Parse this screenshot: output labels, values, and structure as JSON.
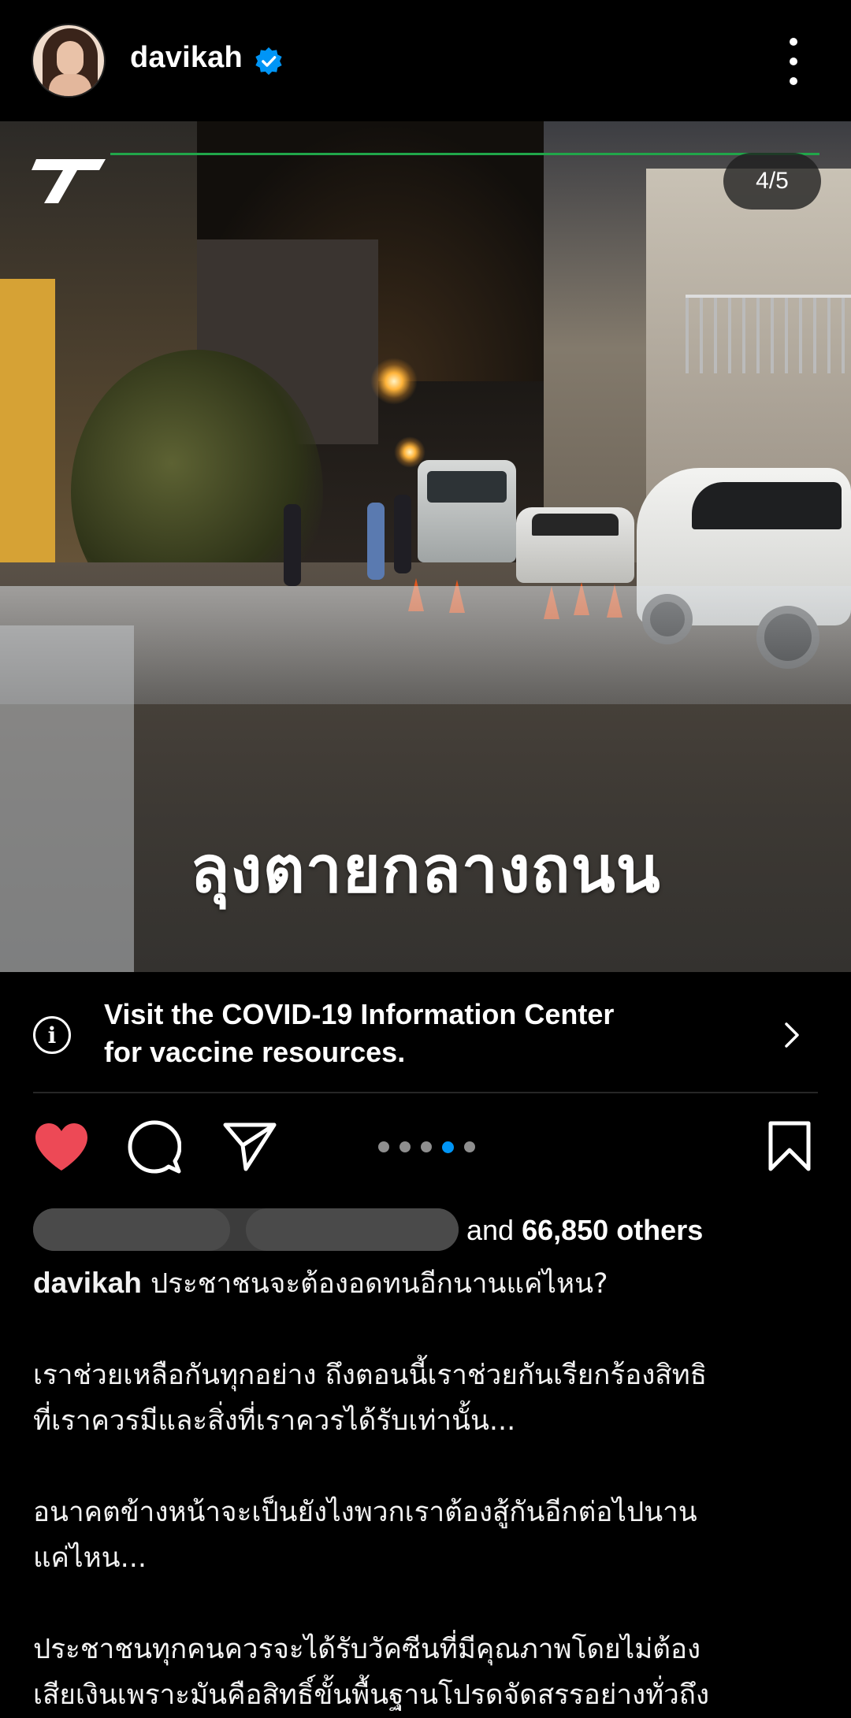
{
  "post": {
    "username": "davikah",
    "verified": true,
    "carousel_counter": "4/5",
    "carousel_total": 5,
    "carousel_active": 4,
    "image_overlay_text": "ลุงตายกลางถนน"
  },
  "info_banner": {
    "line1": "Visit the COVID-19 Information Center",
    "line2": "for vaccine resources."
  },
  "actions": {
    "liked": true,
    "icons": [
      "heart-icon",
      "comment-icon",
      "share-icon",
      "bookmark-icon"
    ]
  },
  "likes": {
    "prefix": "and",
    "count_text": "66,850 others"
  },
  "caption": {
    "author": "davikah",
    "first_line": "ประชาชนจะต้องอดทนอีกนานแค่ไหน?",
    "para1_line1": "เราช่วยเหลือกันทุกอย่าง ถึงตอนนี้เราช่วยกันเรียกร้องสิทธิ",
    "para1_line2": "ที่เราควรมีและสิ่งที่เราควรได้รับเท่านั้น...",
    "para2_line1": "อนาคตข้างหน้าจะเป็นยังไงพวกเราต้องสู้กันอีกต่อไปนาน",
    "para2_line2": "แค่ไหน...",
    "para3_line1": "ประชาชนทุกคนควรจะได้รับวัคซีนที่มีคุณภาพโดยไม่ต้อง",
    "para3_line2": "เสียเงินเพราะมันคือสิทธิ์ขั้นพื้นฐานโปรดจัดสรรอย่างทั่วถึง"
  },
  "colors": {
    "background": "#000000",
    "heart": "#ed4956",
    "verified": "#0095f6",
    "active_dot": "#0095f6",
    "inactive_dot": "#8e8e8e"
  }
}
